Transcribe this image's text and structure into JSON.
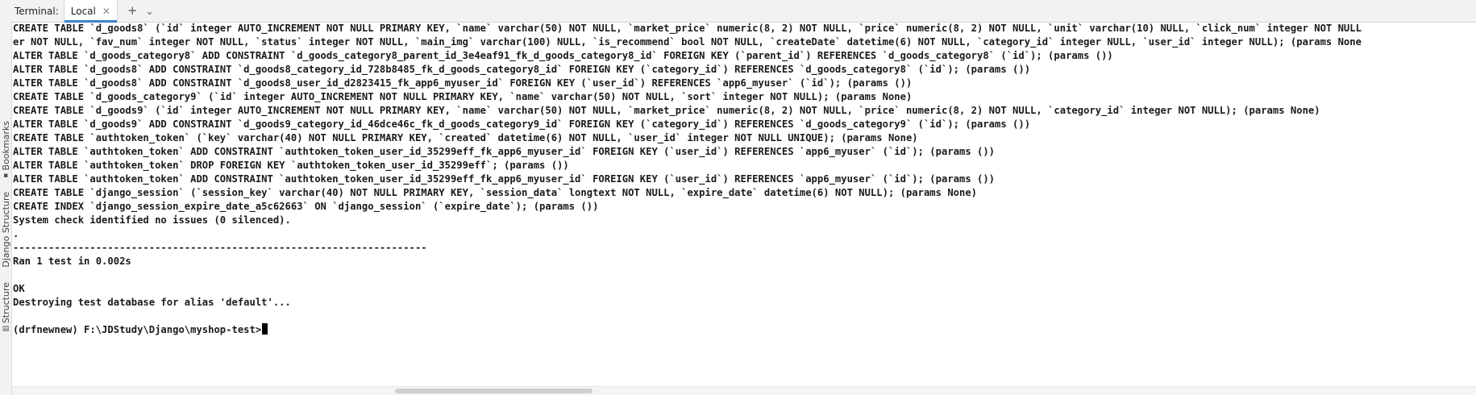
{
  "side_panel": {
    "bookmarks_label": "Bookmarks",
    "django_structure_label": "Django Structure",
    "structure_label": "Structure"
  },
  "tabbar": {
    "terminal_label": "Terminal:",
    "tab_local_label": "Local",
    "close_glyph": "✕",
    "new_tab_glyph": "+",
    "dropdown_glyph": "⌄"
  },
  "terminal": {
    "lines": [
      "CREATE TABLE `d_goods8` (`id` integer AUTO_INCREMENT NOT NULL PRIMARY KEY, `name` varchar(50) NOT NULL, `market_price` numeric(8, 2) NOT NULL, `price` numeric(8, 2) NOT NULL, `unit` varchar(10) NULL, `click_num` integer NOT NULL",
      "er NOT NULL, `fav_num` integer NOT NULL, `status` integer NOT NULL, `main_img` varchar(100) NULL, `is_recommend` bool NOT NULL, `createDate` datetime(6) NOT NULL, `category_id` integer NULL, `user_id` integer NULL); (params None",
      "ALTER TABLE `d_goods_category8` ADD CONSTRAINT `d_goods_category8_parent_id_3e4eaf91_fk_d_goods_category8_id` FOREIGN KEY (`parent_id`) REFERENCES `d_goods_category8` (`id`); (params ())",
      "ALTER TABLE `d_goods8` ADD CONSTRAINT `d_goods8_category_id_728b8485_fk_d_goods_category8_id` FOREIGN KEY (`category_id`) REFERENCES `d_goods_category8` (`id`); (params ())",
      "ALTER TABLE `d_goods8` ADD CONSTRAINT `d_goods8_user_id_d2823415_fk_app6_myuser_id` FOREIGN KEY (`user_id`) REFERENCES `app6_myuser` (`id`); (params ())",
      "CREATE TABLE `d_goods_category9` (`id` integer AUTO_INCREMENT NOT NULL PRIMARY KEY, `name` varchar(50) NOT NULL, `sort` integer NOT NULL); (params None)",
      "CREATE TABLE `d_goods9` (`id` integer AUTO_INCREMENT NOT NULL PRIMARY KEY, `name` varchar(50) NOT NULL, `market_price` numeric(8, 2) NOT NULL, `price` numeric(8, 2) NOT NULL, `category_id` integer NOT NULL); (params None)",
      "ALTER TABLE `d_goods9` ADD CONSTRAINT `d_goods9_category_id_46dce46c_fk_d_goods_category9_id` FOREIGN KEY (`category_id`) REFERENCES `d_goods_category9` (`id`); (params ())",
      "CREATE TABLE `authtoken_token` (`key` varchar(40) NOT NULL PRIMARY KEY, `created` datetime(6) NOT NULL, `user_id` integer NOT NULL UNIQUE); (params None)",
      "ALTER TABLE `authtoken_token` ADD CONSTRAINT `authtoken_token_user_id_35299eff_fk_app6_myuser_id` FOREIGN KEY (`user_id`) REFERENCES `app6_myuser` (`id`); (params ())",
      "ALTER TABLE `authtoken_token` DROP FOREIGN KEY `authtoken_token_user_id_35299eff`; (params ())",
      "ALTER TABLE `authtoken_token` ADD CONSTRAINT `authtoken_token_user_id_35299eff_fk_app6_myuser_id` FOREIGN KEY (`user_id`) REFERENCES `app6_myuser` (`id`); (params ())",
      "CREATE TABLE `django_session` (`session_key` varchar(40) NOT NULL PRIMARY KEY, `session_data` longtext NOT NULL, `expire_date` datetime(6) NOT NULL); (params None)",
      "CREATE INDEX `django_session_expire_date_a5c62663` ON `django_session` (`expire_date`); (params ())",
      "System check identified no issues (0 silenced).",
      ".",
      "----------------------------------------------------------------------",
      "Ran 1 test in 0.002s",
      "",
      "OK",
      "Destroying test database for alias 'default'...",
      ""
    ],
    "prompt": "(drfnewnew) F:\\JDStudy\\Django\\myshop-test>"
  }
}
